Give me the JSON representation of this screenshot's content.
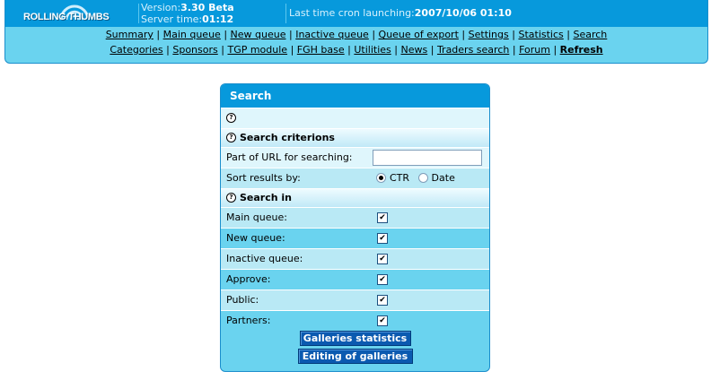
{
  "header": {
    "logo_text": "ROLLING THUMBS",
    "version_label": "Version:",
    "version_value": "3.30 Beta",
    "server_time_label": "Server time:",
    "server_time_value": "01:12",
    "cron_label": "Last time cron launching:",
    "cron_value": "2007/10/06 01:10"
  },
  "nav": {
    "row1": [
      "Summary",
      "Main queue",
      "New queue",
      "Inactive queue",
      "Queue of export",
      "Settings",
      "Statistics",
      "Search"
    ],
    "row2": [
      "Categories",
      "Sponsors",
      "TGP module",
      "FGH base",
      "Utilities",
      "News",
      "Traders search",
      "Forum",
      "Refresh"
    ],
    "separator": "|"
  },
  "panel": {
    "title": "Search",
    "help_glyph": "?",
    "criteria_title": "Search criterions",
    "url_label": "Part of URL for searching:",
    "url_value": "",
    "sort_label": "Sort results by:",
    "sort_options": [
      "CTR",
      "Date"
    ],
    "sort_selected": "CTR",
    "search_in_title": "Search in",
    "search_in": [
      {
        "label": "Main queue:",
        "checked": true
      },
      {
        "label": "New queue:",
        "checked": true
      },
      {
        "label": "Inactive queue:",
        "checked": true
      },
      {
        "label": "Approve:",
        "checked": true
      },
      {
        "label": "Public:",
        "checked": true
      },
      {
        "label": "Partners:",
        "checked": true
      }
    ],
    "check_glyph": "✔",
    "buttons": [
      "Galleries statistics",
      "Editing of galleries"
    ]
  },
  "colors": {
    "header_blue": "#0799dc",
    "panel_blue": "#6ad3ef",
    "button_blue": "#0b5ab0"
  }
}
